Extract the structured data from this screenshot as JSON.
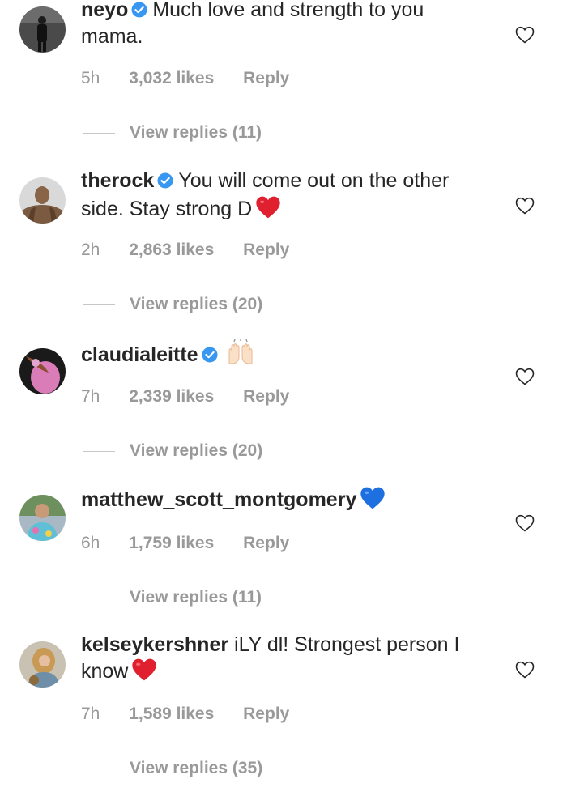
{
  "comments": [
    {
      "username": "neyo",
      "verified": true,
      "text": "Much love and strength to you mama.",
      "time": "5h",
      "likes": "3,032 likes",
      "reply": "Reply",
      "view_replies": "View replies (11)"
    },
    {
      "username": "therock",
      "verified": true,
      "text": "You will come out on the other side. Stay strong D",
      "emoji": "red-heart",
      "time": "2h",
      "likes": "2,863 likes",
      "reply": "Reply",
      "view_replies": "View replies (20)"
    },
    {
      "username": "claudialeitte",
      "verified": true,
      "text": "",
      "emoji": "raising-hands",
      "time": "7h",
      "likes": "2,339 likes",
      "reply": "Reply",
      "view_replies": "View replies (20)"
    },
    {
      "username": "matthew_scott_montgomery",
      "verified": false,
      "text": "",
      "emoji": "blue-heart",
      "time": "6h",
      "likes": "1,759 likes",
      "reply": "Reply",
      "view_replies": "View replies (11)"
    },
    {
      "username": "kelseykershner",
      "verified": false,
      "text": "iLY dl! Strongest person I know",
      "emoji": "red-heart",
      "time": "7h",
      "likes": "1,589 likes",
      "reply": "Reply",
      "view_replies": "View replies (35)"
    }
  ],
  "colors": {
    "text": "#262626",
    "muted": "#999999",
    "verified_blue": "#3897f0",
    "red_heart": "#e0202f",
    "blue_heart": "#1e6fe0"
  }
}
